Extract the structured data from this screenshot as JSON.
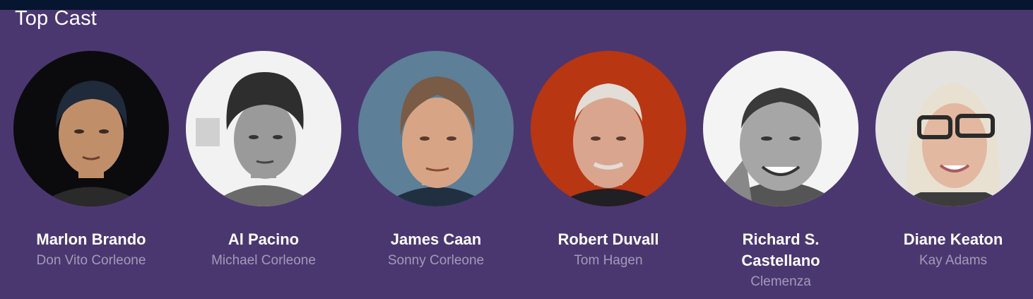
{
  "section": {
    "title": "Top Cast"
  },
  "cast": [
    {
      "name": "Marlon Brando",
      "character": "Don Vito Corleone",
      "bg": "#0b0b0d",
      "skin": "#c08f6a",
      "hair": "#1f2a3a"
    },
    {
      "name": "Al Pacino",
      "character": "Michael Corleone",
      "bg": "#f2f2f2",
      "skin": "#9a9a9a",
      "hair": "#2e2e2e"
    },
    {
      "name": "James Caan",
      "character": "Sonny Corleone",
      "bg": "#5d7f98",
      "skin": "#d7a585",
      "hair": "#7a5b45"
    },
    {
      "name": "Robert Duvall",
      "character": "Tom Hagen",
      "bg": "#b83612",
      "skin": "#d9a58e",
      "hair": "#e2ddd6"
    },
    {
      "name": "Richard S. Castellano",
      "character": "Clemenza",
      "bg": "#f4f4f4",
      "skin": "#a6a6a6",
      "hair": "#3a3a3a"
    },
    {
      "name": "Diane Keaton",
      "character": "Kay Adams",
      "bg": "#e5e3e0",
      "skin": "#e2b8a0",
      "hair": "#e8e1d2"
    }
  ]
}
